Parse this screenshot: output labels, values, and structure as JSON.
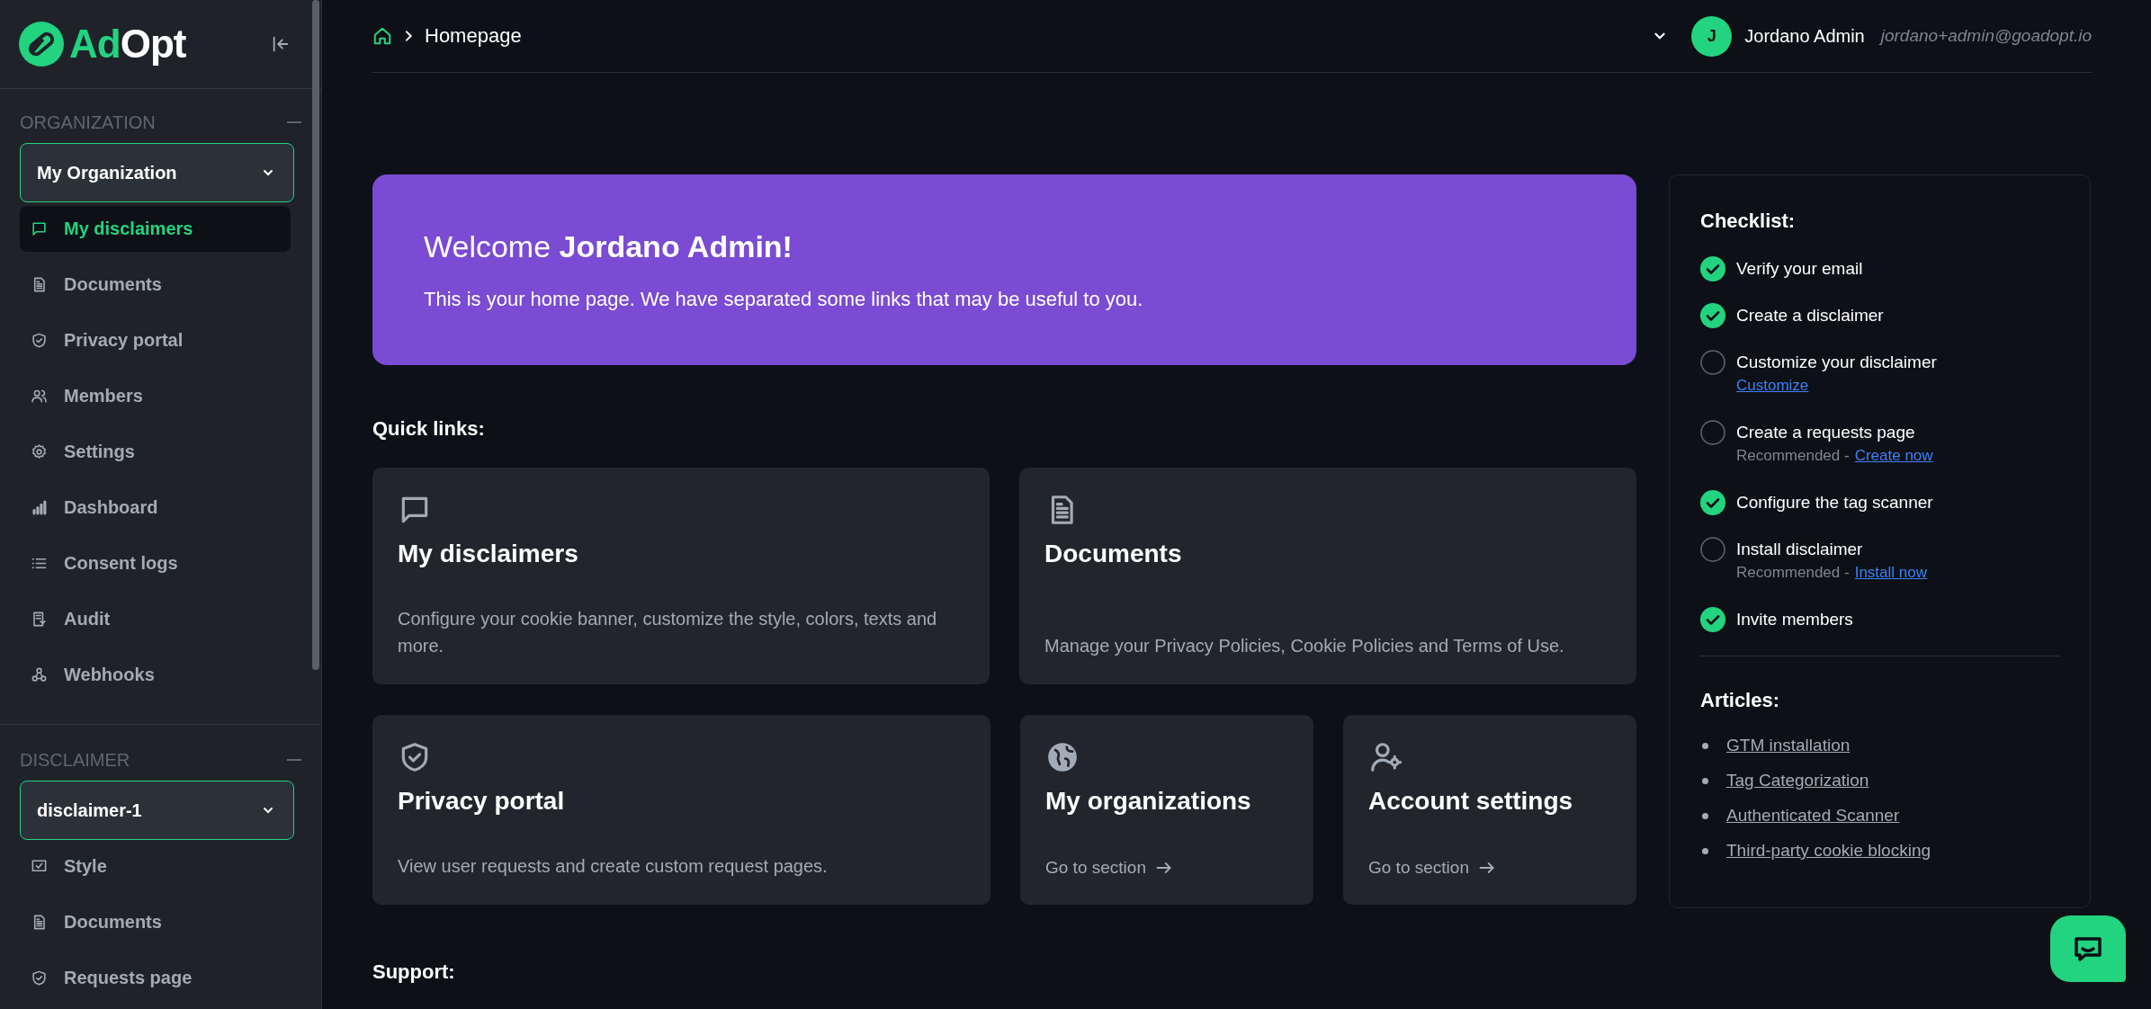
{
  "sidebar": {
    "logo": {
      "accent": "Ad",
      "rest": "Opt"
    },
    "sections": [
      {
        "title": "ORGANIZATION",
        "dropdown": "My Organization",
        "items": [
          {
            "label": "My disclaimers",
            "selected": true
          },
          {
            "label": "Documents",
            "selected": false
          },
          {
            "label": "Privacy portal",
            "selected": false
          },
          {
            "label": "Members",
            "selected": false
          },
          {
            "label": "Settings",
            "selected": false
          },
          {
            "label": "Dashboard",
            "selected": false
          },
          {
            "label": "Consent logs",
            "selected": false
          },
          {
            "label": "Audit",
            "selected": false
          },
          {
            "label": "Webhooks",
            "selected": false
          }
        ]
      },
      {
        "title": "DISCLAIMER",
        "dropdown": "disclaimer-1",
        "items": [
          {
            "label": "Style",
            "selected": false
          },
          {
            "label": "Documents",
            "selected": false
          },
          {
            "label": "Requests page",
            "selected": false
          }
        ]
      }
    ]
  },
  "header": {
    "breadcrumb": "Homepage",
    "user": {
      "initial": "J",
      "name": "Jordano Admin",
      "email": "jordano+admin@goadopt.io"
    }
  },
  "welcome": {
    "title": "Welcome **Jordano Admin!**",
    "text": "This is your home page. We have separated some links that may be useful to you."
  },
  "quick_links": {
    "title": "Quick links:",
    "cards": [
      {
        "title": "My disclaimers",
        "description": "Configure your cookie banner, customize the style, colors, texts and more."
      },
      {
        "title": "Documents",
        "description": "Manage your Privacy Policies, Cookie Policies and Terms of Use."
      },
      {
        "title": "Privacy portal",
        "description": "View user requests and create custom request pages."
      },
      {
        "title": "My organizations",
        "link": "Go to section"
      },
      {
        "title": "Account settings",
        "link": "Go to section"
      }
    ]
  },
  "support": {
    "title": "Support:"
  },
  "checklist": {
    "title": "Checklist:",
    "items": [
      {
        "label": "Verify your email",
        "done": true
      },
      {
        "label": "Create a disclaimer",
        "done": true
      },
      {
        "label": "Customize your disclaimer",
        "done": false,
        "link": "Customize"
      },
      {
        "label": "Create a requests page",
        "done": false,
        "note": "Recommended -",
        "link": "Create now"
      },
      {
        "label": "Configure the tag scanner",
        "done": true
      },
      {
        "label": "Install disclaimer",
        "done": false,
        "note": "Recommended -",
        "link": "Install now"
      },
      {
        "label": "Invite members",
        "done": true
      }
    ]
  },
  "articles": {
    "title": "Articles:",
    "links": [
      "GTM installation",
      "Tag Categorization",
      "Authenticated Scanner",
      "Third-party cookie blocking"
    ]
  }
}
